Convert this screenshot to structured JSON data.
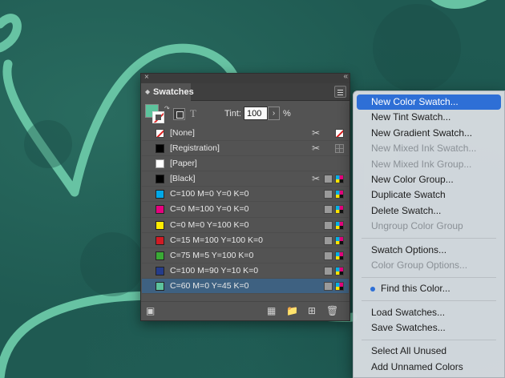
{
  "panel": {
    "close_glyph": "×",
    "collapse_glyph": "«",
    "tab_title": "Swatches",
    "tint_label": "Tint:",
    "tint_value": "100",
    "tint_stepper": "›",
    "tint_unit": "%",
    "text_format_glyph": "T",
    "fill_color": "#5dc39d",
    "swatches": [
      {
        "name": "[None]",
        "color": "none",
        "icons": [
          "scissors",
          "none"
        ]
      },
      {
        "name": "[Registration]",
        "color": "#000000",
        "icons": [
          "scissors",
          "registration"
        ]
      },
      {
        "name": "[Paper]",
        "color": "#ffffff",
        "icons": []
      },
      {
        "name": "[Black]",
        "color": "#000000",
        "icons": [
          "scissors",
          "gray",
          "cmyk"
        ]
      },
      {
        "name": "C=100 M=0 Y=0 K=0",
        "color": "#00a8e8",
        "icons": [
          "gray",
          "cmyk"
        ]
      },
      {
        "name": "C=0 M=100 Y=0 K=0",
        "color": "#e6007e",
        "icons": [
          "gray",
          "cmyk"
        ]
      },
      {
        "name": "C=0 M=0 Y=100 K=0",
        "color": "#ffec00",
        "icons": [
          "gray",
          "cmyk"
        ]
      },
      {
        "name": "C=15 M=100 Y=100 K=0",
        "color": "#d11b24",
        "icons": [
          "gray",
          "cmyk"
        ]
      },
      {
        "name": "C=75 M=5 Y=100 K=0",
        "color": "#3aa935",
        "icons": [
          "gray",
          "cmyk"
        ]
      },
      {
        "name": "C=100 M=90 Y=10 K=0",
        "color": "#253c8a",
        "icons": [
          "gray",
          "cmyk"
        ]
      },
      {
        "name": "C=60 M=0 Y=45 K=0",
        "color": "#5dc39d",
        "icons": [
          "gray",
          "cmyk"
        ],
        "selected": true
      }
    ]
  },
  "menu": {
    "items": [
      {
        "label": "New Color Swatch...",
        "state": "highlighted"
      },
      {
        "label": "New Tint Swatch...",
        "state": "enabled"
      },
      {
        "label": "New Gradient Swatch...",
        "state": "enabled"
      },
      {
        "label": "New Mixed Ink Swatch...",
        "state": "disabled"
      },
      {
        "label": "New Mixed Ink Group...",
        "state": "disabled"
      },
      {
        "label": "New Color Group...",
        "state": "enabled"
      },
      {
        "label": "Duplicate Swatch",
        "state": "enabled"
      },
      {
        "label": "Delete Swatch...",
        "state": "enabled"
      },
      {
        "label": "Ungroup Color Group",
        "state": "disabled"
      },
      {
        "separator": true
      },
      {
        "label": "Swatch Options...",
        "state": "enabled"
      },
      {
        "label": "Color Group Options...",
        "state": "disabled"
      },
      {
        "separator": true
      },
      {
        "label": "Find this Color...",
        "state": "enabled",
        "dot": true
      },
      {
        "separator": true
      },
      {
        "label": "Load Swatches...",
        "state": "enabled"
      },
      {
        "label": "Save Swatches...",
        "state": "enabled"
      },
      {
        "separator": true
      },
      {
        "label": "Select All Unused",
        "state": "enabled"
      },
      {
        "label": "Add Unnamed Colors",
        "state": "enabled"
      }
    ]
  },
  "colors": {
    "highlight": "#2e6fd6",
    "selected_row": "#3e6181",
    "background": "#1f5a52",
    "art_stroke": "#67c3a3"
  }
}
